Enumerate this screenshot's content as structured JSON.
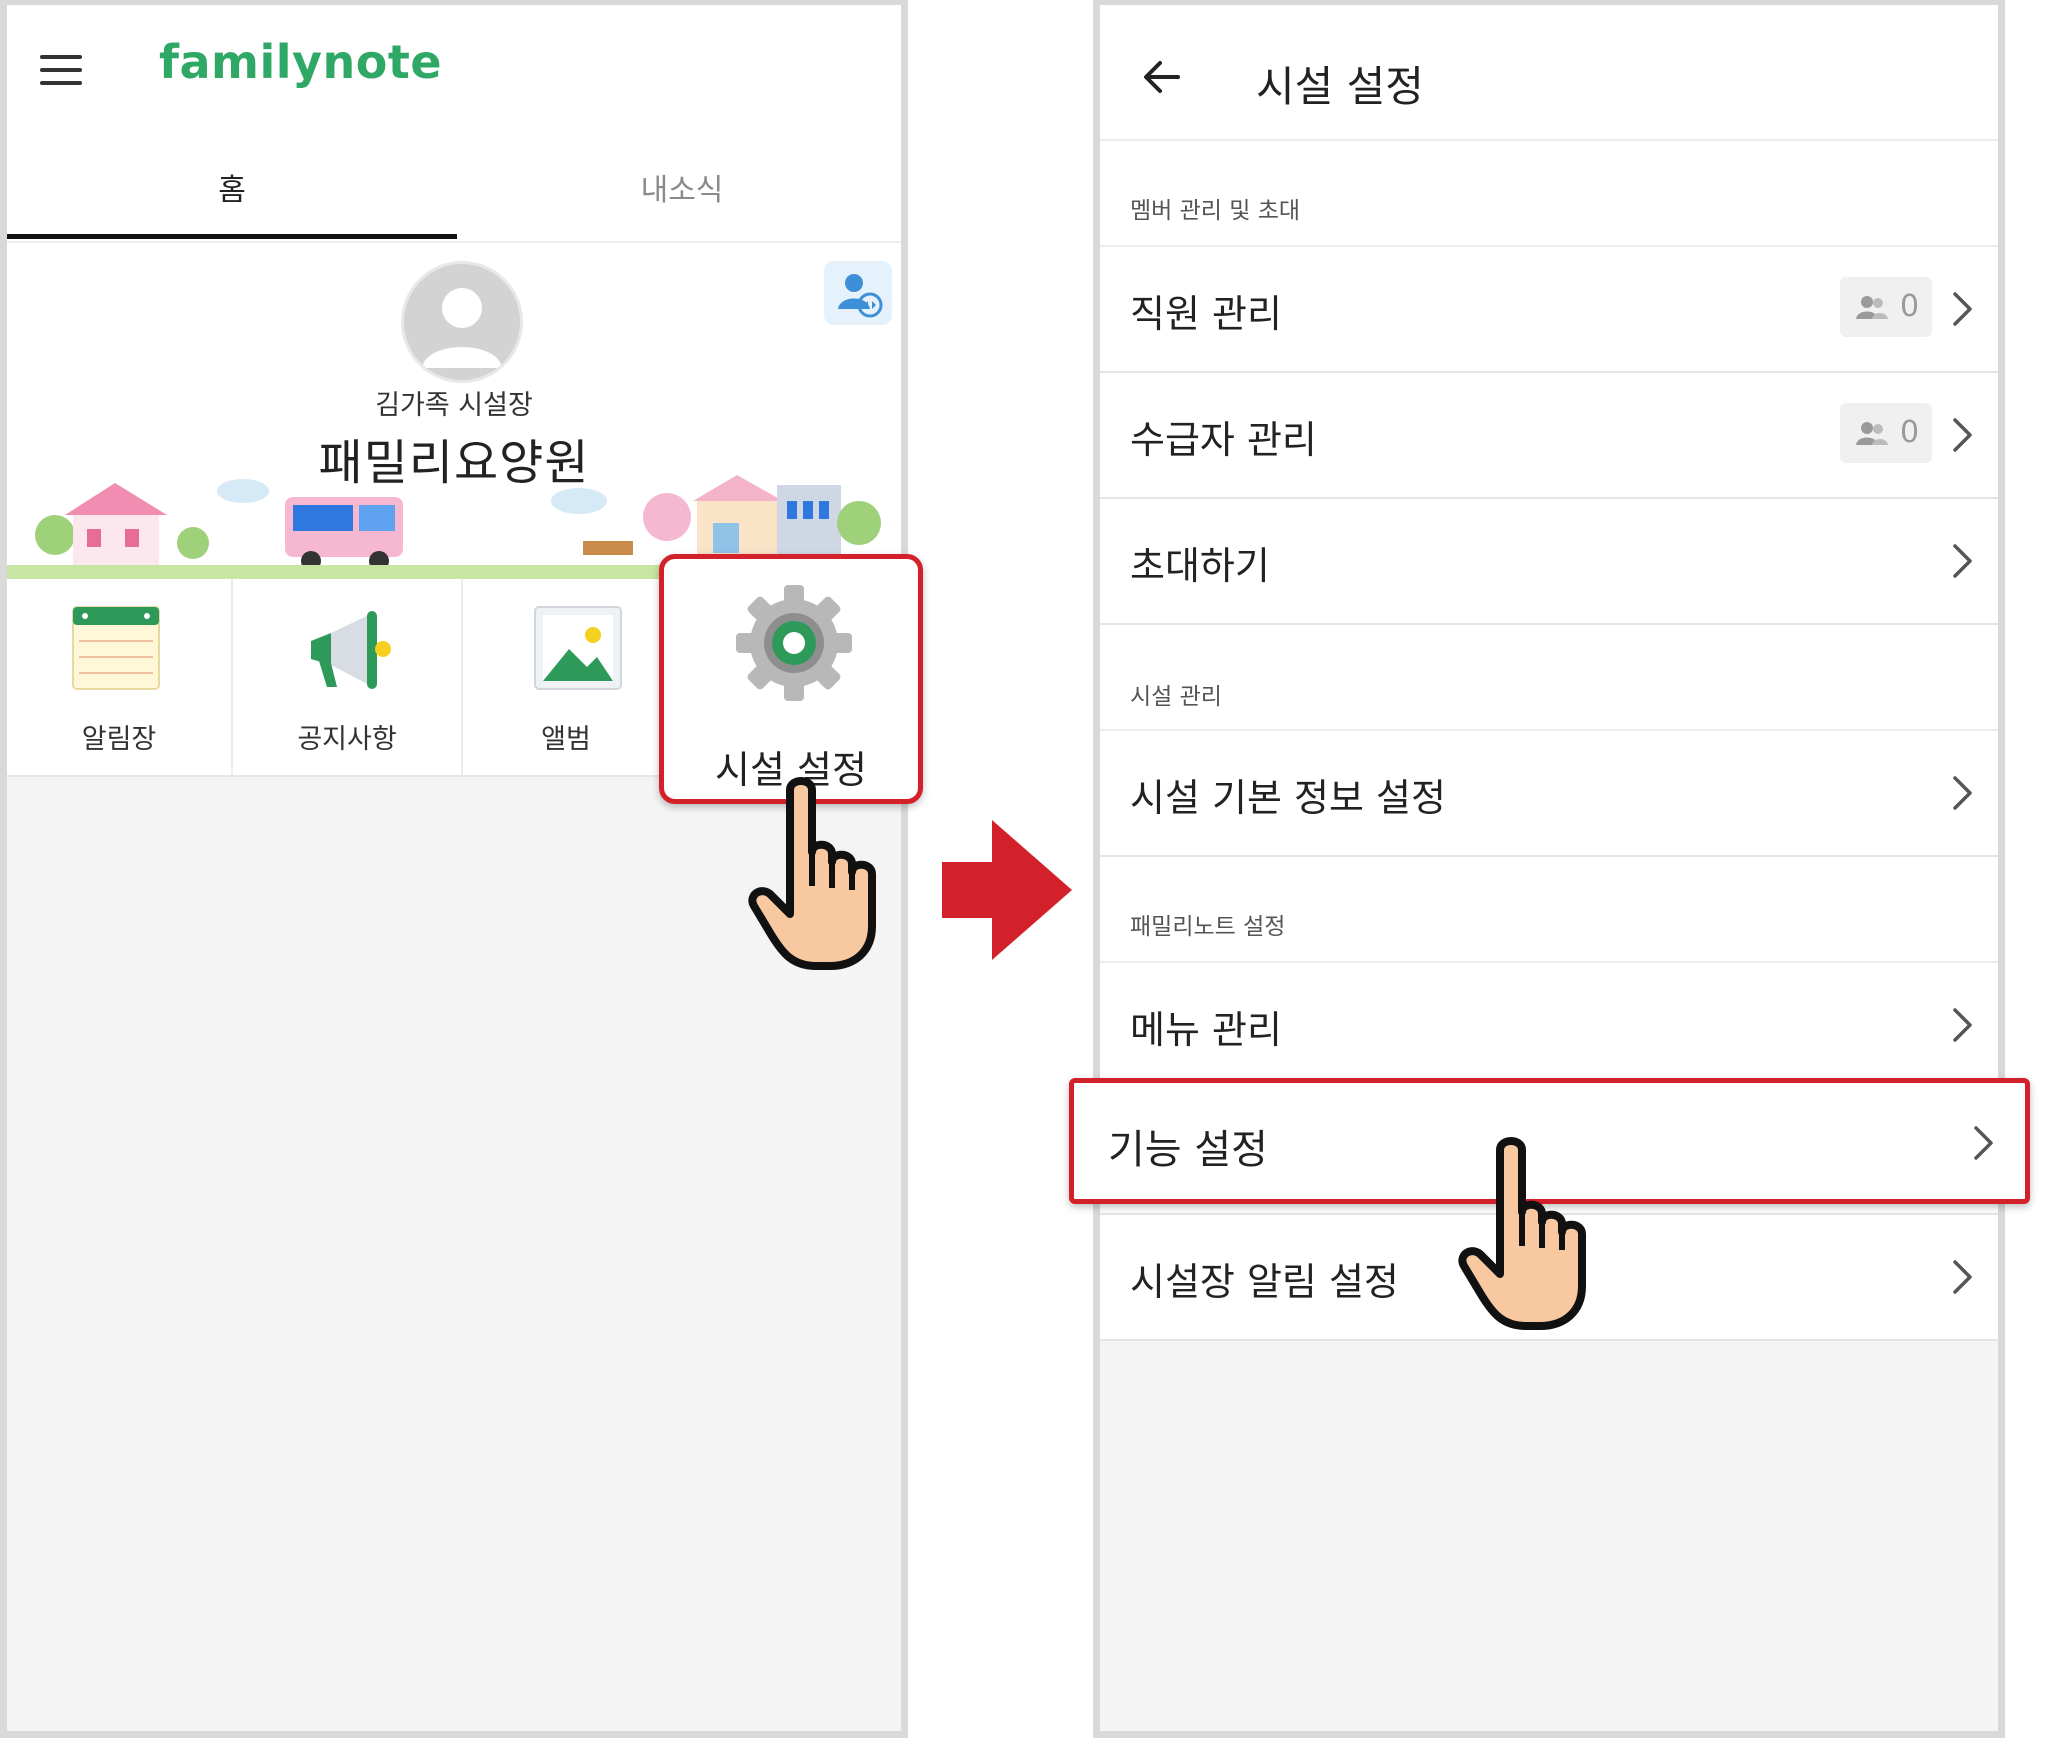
{
  "left_screen": {
    "brand": "familynote",
    "tabs": [
      {
        "label": "홈",
        "active": true
      },
      {
        "label": "내소식",
        "active": false
      }
    ],
    "profile": {
      "role": "김가족 시설장",
      "facility_name": "패밀리요양원"
    },
    "menu": [
      {
        "label": "알림장",
        "icon": "notebook-icon"
      },
      {
        "label": "공지사항",
        "icon": "megaphone-icon"
      },
      {
        "label": "앨범",
        "icon": "photo-icon"
      },
      {
        "label": "시설 설정",
        "icon": "gear-icon",
        "highlighted": true
      }
    ]
  },
  "right_screen": {
    "title": "시설 설정",
    "sections": [
      {
        "header": "멤버 관리 및 초대",
        "items": [
          {
            "label": "직원 관리",
            "count": "0"
          },
          {
            "label": "수급자 관리",
            "count": "0"
          },
          {
            "label": "초대하기"
          }
        ]
      },
      {
        "header": "시설 관리",
        "items": [
          {
            "label": "시설 기본 정보 설정"
          }
        ]
      },
      {
        "header": "패밀리노트 설정",
        "items": [
          {
            "label": "메뉴 관리"
          },
          {
            "label": "기능 설정",
            "highlighted": true
          },
          {
            "label": "시설장 알림 설정"
          }
        ]
      }
    ]
  },
  "colors": {
    "brand_green": "#2fa866",
    "highlight_red": "#d3212b",
    "background_gray": "#f4f4f4"
  }
}
